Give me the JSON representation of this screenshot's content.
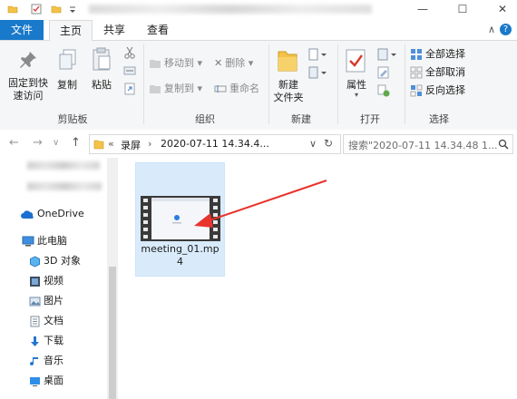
{
  "window": {
    "minimize_glyph": "—",
    "maximize_glyph": "☐",
    "close_glyph": "✕"
  },
  "ribbon_tabs": {
    "file": "文件",
    "home": "主页",
    "share": "共享",
    "view": "查看",
    "collapse_glyph": "∧",
    "help_glyph": "?"
  },
  "ribbon": {
    "clipboard": {
      "group": "剪贴板",
      "pin_line1": "固定到快",
      "pin_line2": "速访问",
      "copy": "复制",
      "paste": "粘贴"
    },
    "organize": {
      "group": "组织",
      "move_to": "移动到",
      "copy_to": "复制到",
      "delete": "删除",
      "rename": "重命名"
    },
    "new": {
      "group": "新建",
      "new_folder_line1": "新建",
      "new_folder_line2": "文件夹"
    },
    "open": {
      "group": "打开",
      "properties": "属性"
    },
    "select": {
      "group": "选择",
      "select_all": "全部选择",
      "select_none": "全部取消",
      "invert": "反向选择"
    }
  },
  "address": {
    "back": "←",
    "forward": "→",
    "up": "↑",
    "prefix": "«",
    "segment1": "录屏",
    "separator": "›",
    "segment2": "2020-07-11 14.34.4...",
    "dropdown": "∨",
    "refresh": "↻",
    "search_placeholder": "搜索\"2020-07-11 14.34.48 1...",
    "search_icon": "magnifier-icon"
  },
  "navpane": {
    "onedrive": "OneDrive",
    "this_pc": "此电脑",
    "objects3d": "3D 对象",
    "videos": "视频",
    "pictures": "图片",
    "documents": "文档",
    "downloads": "下载",
    "music": "音乐",
    "desktop": "桌面"
  },
  "files": [
    {
      "name": "meeting_01.mp4"
    }
  ],
  "colors": {
    "accent": "#1979ca",
    "selection": "#d9ebfb",
    "arrow": "#e8342c"
  }
}
